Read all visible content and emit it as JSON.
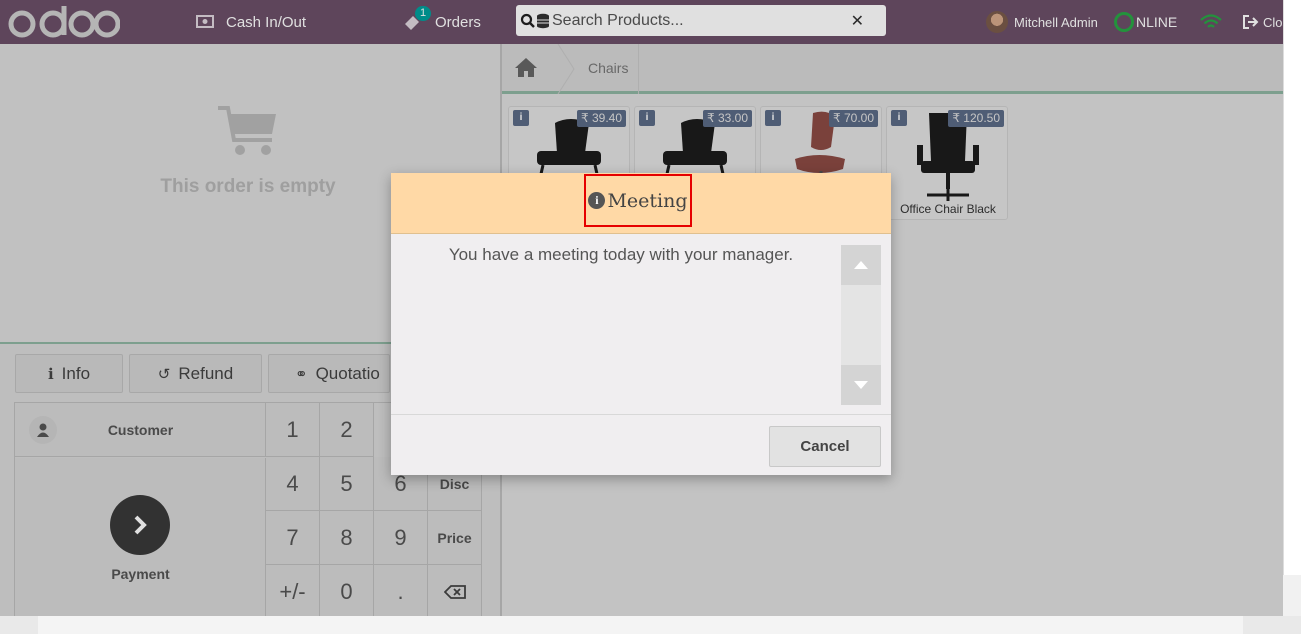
{
  "header": {
    "logo": "odoo",
    "cash_label": "Cash In/Out",
    "orders_label": "Orders",
    "orders_badge": "1",
    "search_placeholder": "Search Products...",
    "user_name": "Mitchell Admin",
    "status": "NLINE",
    "close_label": "Clos"
  },
  "order": {
    "empty_text": "This order is empty"
  },
  "controls": {
    "info": "Info",
    "refund": "Refund",
    "quotation": "Quotatio"
  },
  "numpad": {
    "customer": "Customer",
    "payment": "Payment",
    "keys": [
      "1",
      "2",
      "4",
      "5",
      "6",
      "7",
      "8",
      "9",
      "+/-",
      "0",
      "."
    ],
    "disc": "Disc",
    "price": "Price"
  },
  "breadcrumb": {
    "category": "Chairs"
  },
  "products": [
    {
      "price": "₹ 39.40",
      "name": "",
      "color": "#1c1c1c"
    },
    {
      "price": "₹ 33.00",
      "name": "",
      "color": "#1c1c1c"
    },
    {
      "price": "₹ 70.00",
      "name": "",
      "color": "#8b4a44"
    },
    {
      "price": "₹ 120.50",
      "name": "Office Chair Black",
      "color": "#1c1c1c"
    }
  ],
  "dialog": {
    "title": "Meeting",
    "message": "You have a meeting today with your manager.",
    "cancel": "Cancel"
  },
  "colors": {
    "header": "#6b4f68",
    "dialog_header": "#ffd9a6",
    "highlight": "#e60000"
  }
}
